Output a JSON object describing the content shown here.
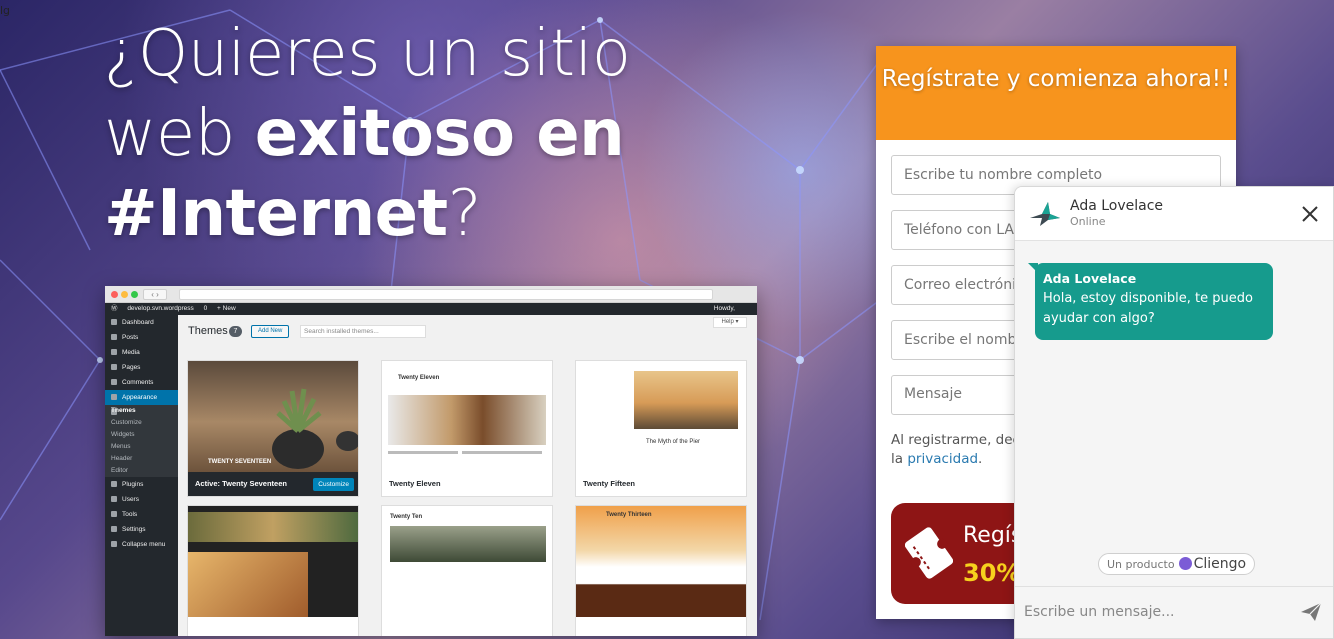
{
  "corner_text": "lg",
  "hero": {
    "line1": "¿Quieres un sitio",
    "line2_regular": "web ",
    "line2_bold": "exitoso en",
    "line3_bold": "#Internet",
    "line3_regular": "?"
  },
  "mockup": {
    "nav_arrows": "‹ ›",
    "admin_bar": {
      "site": "develop.svn.wordpress",
      "comments": "0",
      "new": "+ New",
      "howdy": "Howdy,"
    },
    "sidebar": [
      {
        "label": "Dashboard"
      },
      {
        "label": "Posts"
      },
      {
        "label": "Media"
      },
      {
        "label": "Pages"
      },
      {
        "label": "Comments"
      },
      {
        "label": "Appearance"
      },
      {
        "label": "Plugins"
      },
      {
        "label": "Users"
      },
      {
        "label": "Tools"
      },
      {
        "label": "Settings"
      },
      {
        "label": "Collapse menu"
      }
    ],
    "submenu": [
      "Themes",
      "Customize",
      "Widgets",
      "Menus",
      "Header",
      "Editor"
    ],
    "title": "Themes",
    "count": "7",
    "add_new": "Add New",
    "search_placeholder": "Search installed themes...",
    "help": "Help ▾",
    "themes": [
      {
        "name": "Active: Twenty Seventeen",
        "shot_label": "TWENTY SEVENTEEN",
        "button": "Customize"
      },
      {
        "name": "Twenty Eleven",
        "shot_label": "Twenty Eleven"
      },
      {
        "name": "Twenty Fifteen",
        "shot_label": "The Myth of the Pier"
      },
      {
        "name": "",
        "shot_label": ""
      },
      {
        "name": "",
        "shot_label": "Twenty Ten"
      },
      {
        "name": "",
        "shot_label": "Twenty Thirteen"
      }
    ]
  },
  "form": {
    "title": "Regístrate y comienza ahora!!",
    "name_placeholder": "Escribe tu nombre completo",
    "phone_placeholder": "Teléfono con LADA",
    "email_placeholder": "Correo electrónico",
    "company_placeholder": "Escribe el nombre",
    "message_placeholder": "Mensaje",
    "consent_text": "Al registrarme, declaro que he leído y aceptado la ",
    "privacy_link": "privacidad",
    "consent_end": ".",
    "cta_line1": "Regís",
    "cta_line2": "30%"
  },
  "chat": {
    "agent_name": "Ada Lovelace",
    "agent_status": "Online",
    "message_author": "Ada Lovelace",
    "message_text": "Hola, estoy disponible, te puedo ayudar con algo?",
    "powered_by": "Un producto",
    "brand": "Cliengo",
    "input_placeholder": "Escribe un mensaje..."
  },
  "colors": {
    "form_header": "#f7941d",
    "cta_background": "#8e1515",
    "cta_highlight": "#f7d11d",
    "chat_bubble": "#169b8d",
    "link": "#2a7ab0"
  }
}
